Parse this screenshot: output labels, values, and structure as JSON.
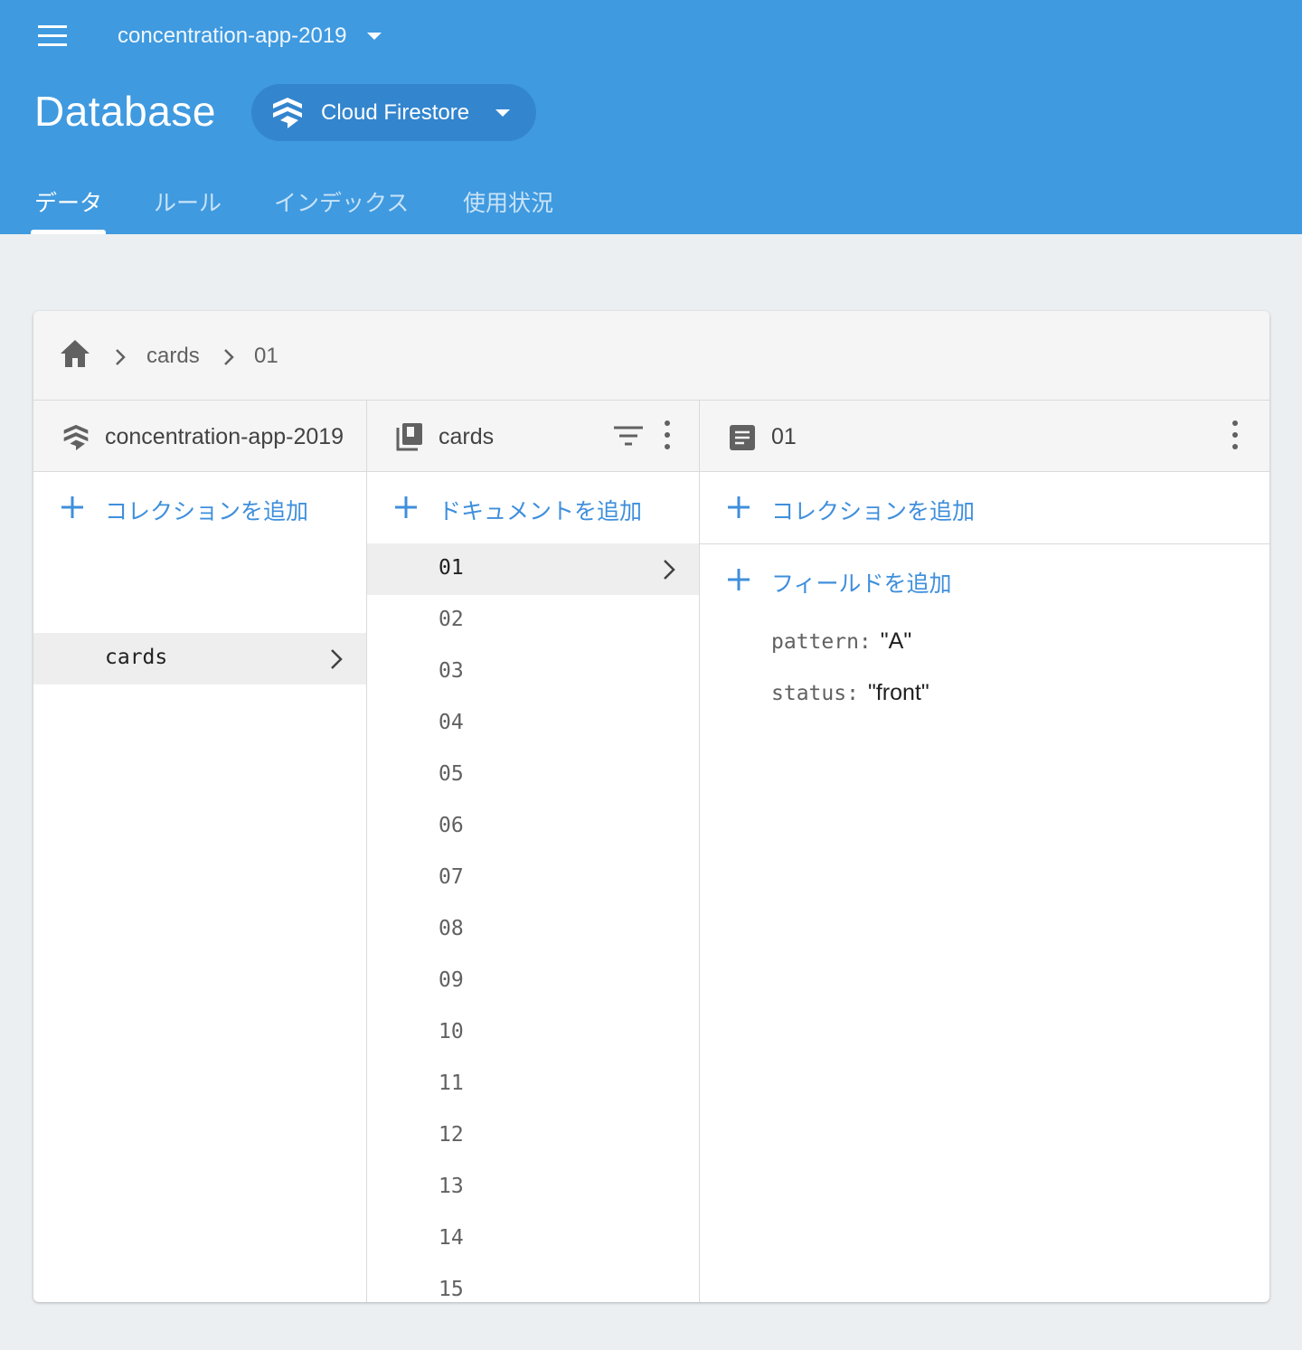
{
  "header": {
    "project_name": "concentration-app-2019",
    "page_title": "Database",
    "product": "Cloud Firestore",
    "tabs": [
      {
        "label": "データ",
        "active": true
      },
      {
        "label": "ルール",
        "active": false
      },
      {
        "label": "インデックス",
        "active": false
      },
      {
        "label": "使用状況",
        "active": false
      }
    ]
  },
  "breadcrumb": {
    "items": [
      "cards",
      "01"
    ]
  },
  "columns": {
    "root": {
      "title": "concentration-app-2019",
      "add_label": "コレクションを追加",
      "items": [
        "cards"
      ],
      "selected": "cards"
    },
    "collection": {
      "title": "cards",
      "add_label": "ドキュメントを追加",
      "items": [
        "01",
        "02",
        "03",
        "04",
        "05",
        "06",
        "07",
        "08",
        "09",
        "10",
        "11",
        "12",
        "13",
        "14",
        "15"
      ],
      "selected": "01"
    },
    "document": {
      "title": "01",
      "add_collection_label": "コレクションを追加",
      "add_field_label": "フィールドを追加",
      "fields": [
        {
          "key": "pattern:",
          "value": "\"A\""
        },
        {
          "key": "status:",
          "value": "\"front\""
        }
      ]
    }
  },
  "colors": {
    "header_bg": "#3f9ae0",
    "accent": "#3f8fdc",
    "page_bg": "#eceff1"
  },
  "icons": {
    "menu": "menu-icon",
    "firestore": "firestore-icon",
    "home": "home-icon",
    "collection": "collection-icon",
    "document": "document-icon",
    "filter": "filter-icon",
    "more": "more-vert-icon",
    "add": "plus-icon",
    "chevron": "chevron-right-icon"
  }
}
